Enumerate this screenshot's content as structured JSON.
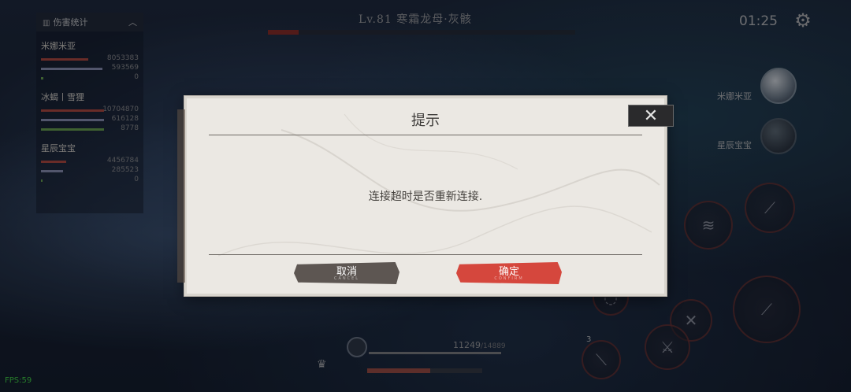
{
  "hud": {
    "damage_title": "伤害统计",
    "players": [
      {
        "name": "米娜米亚",
        "stats": [
          "8053383",
          "593569",
          "0"
        ]
      },
      {
        "name": "冰蝎丨雪狸",
        "stats": [
          "10704870",
          "616128",
          "8778"
        ]
      },
      {
        "name": "星辰宝宝",
        "stats": [
          "4456784",
          "285523",
          "0"
        ]
      }
    ],
    "boss_title": "Lv.81  寒霜龙母·灰骸",
    "timer": "01:25",
    "allies": [
      "米娜米亚",
      "星辰宝宝"
    ],
    "hp_value": "11249",
    "hp_max": "/14889",
    "skill_charges": "3",
    "fps": "FPS:59"
  },
  "dialog": {
    "title": "提示",
    "message": "连接超时是否重新连接.",
    "cancel_label": "取消",
    "ok_label": "确定",
    "cancel_sub": "CANCEL",
    "ok_sub": "CONFIRM"
  },
  "colors": {
    "accent_red": "#d5473d",
    "cancel_gray": "#5d5652",
    "dialog_bg": "#ebe8e3"
  }
}
